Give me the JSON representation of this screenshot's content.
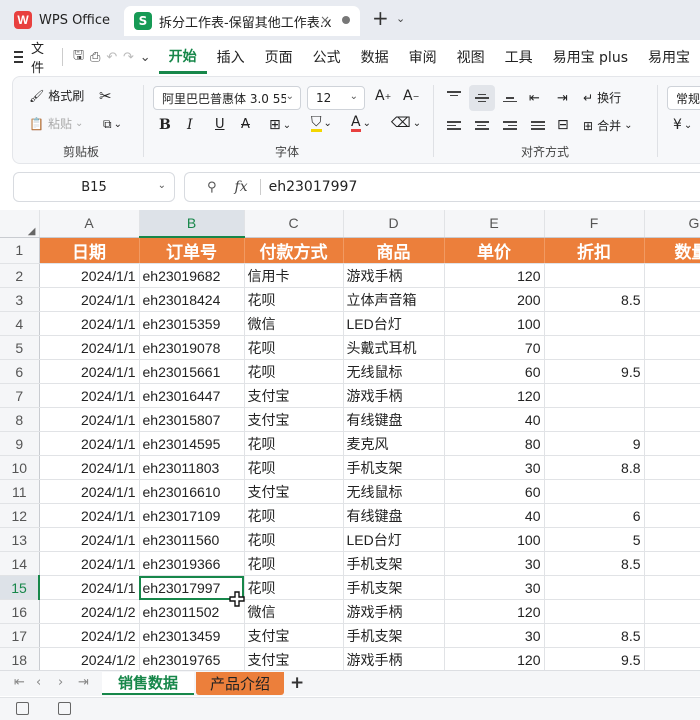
{
  "titlebar": {
    "app_tab": "WPS Office",
    "app_logo": "W",
    "doc_tab": "拆分工作表-保留其他工作表.x",
    "doc_logo": "S",
    "close_glyph": "×",
    "newtab_glyph": "+"
  },
  "menubar": {
    "file": "文件",
    "items": [
      "开始",
      "插入",
      "页面",
      "公式",
      "数据",
      "审阅",
      "视图",
      "工具",
      "易用宝 plus",
      "易用宝"
    ]
  },
  "ribbon": {
    "format_painter": "格式刷",
    "paste": "粘贴",
    "clipboard_group": "剪贴板",
    "font_name": "阿里巴巴普惠体 3.0 55",
    "font_size": "12",
    "font_group": "字体",
    "wrap": "换行",
    "merge": "合并",
    "align_group": "对齐方式",
    "number_format": "常规",
    "currency_glyph": "¥"
  },
  "formula_bar": {
    "cell_ref": "B15",
    "fx": "fx",
    "value": "eh23017997"
  },
  "grid": {
    "columns": [
      "A",
      "B",
      "C",
      "D",
      "E",
      "F",
      "G"
    ],
    "selected_column": "B",
    "selected_row": "15",
    "header_row_num": "1",
    "headers": [
      "日期",
      "订单号",
      "付款方式",
      "商品",
      "单价",
      "折扣",
      "数量"
    ],
    "rows": [
      {
        "n": "2",
        "date": "2024/1/1",
        "order": "eh23019682",
        "pay": "信用卡",
        "item": "游戏手柄",
        "price": "120",
        "disc": ""
      },
      {
        "n": "3",
        "date": "2024/1/1",
        "order": "eh23018424",
        "pay": "花呗",
        "item": "立体声音箱",
        "price": "200",
        "disc": "8.5"
      },
      {
        "n": "4",
        "date": "2024/1/1",
        "order": "eh23015359",
        "pay": "微信",
        "item": "LED台灯",
        "price": "100",
        "disc": ""
      },
      {
        "n": "5",
        "date": "2024/1/1",
        "order": "eh23019078",
        "pay": "花呗",
        "item": "头戴式耳机",
        "price": "70",
        "disc": ""
      },
      {
        "n": "6",
        "date": "2024/1/1",
        "order": "eh23015661",
        "pay": "花呗",
        "item": "无线鼠标",
        "price": "60",
        "disc": "9.5"
      },
      {
        "n": "7",
        "date": "2024/1/1",
        "order": "eh23016447",
        "pay": "支付宝",
        "item": "游戏手柄",
        "price": "120",
        "disc": ""
      },
      {
        "n": "8",
        "date": "2024/1/1",
        "order": "eh23015807",
        "pay": "支付宝",
        "item": "有线键盘",
        "price": "40",
        "disc": ""
      },
      {
        "n": "9",
        "date": "2024/1/1",
        "order": "eh23014595",
        "pay": "花呗",
        "item": "麦克风",
        "price": "80",
        "disc": "9"
      },
      {
        "n": "10",
        "date": "2024/1/1",
        "order": "eh23011803",
        "pay": "花呗",
        "item": "手机支架",
        "price": "30",
        "disc": "8.8"
      },
      {
        "n": "11",
        "date": "2024/1/1",
        "order": "eh23016610",
        "pay": "支付宝",
        "item": "无线鼠标",
        "price": "60",
        "disc": ""
      },
      {
        "n": "12",
        "date": "2024/1/1",
        "order": "eh23017109",
        "pay": "花呗",
        "item": "有线键盘",
        "price": "40",
        "disc": "6"
      },
      {
        "n": "13",
        "date": "2024/1/1",
        "order": "eh23011560",
        "pay": "花呗",
        "item": "LED台灯",
        "price": "100",
        "disc": "5"
      },
      {
        "n": "14",
        "date": "2024/1/1",
        "order": "eh23019366",
        "pay": "花呗",
        "item": "手机支架",
        "price": "30",
        "disc": "8.5"
      },
      {
        "n": "15",
        "date": "2024/1/1",
        "order": "eh23017997",
        "pay": "花呗",
        "item": "手机支架",
        "price": "30",
        "disc": ""
      },
      {
        "n": "16",
        "date": "2024/1/2",
        "order": "eh23011502",
        "pay": "微信",
        "item": "游戏手柄",
        "price": "120",
        "disc": ""
      },
      {
        "n": "17",
        "date": "2024/1/2",
        "order": "eh23013459",
        "pay": "支付宝",
        "item": "手机支架",
        "price": "30",
        "disc": "8.5"
      },
      {
        "n": "18",
        "date": "2024/1/2",
        "order": "eh23019765",
        "pay": "支付宝",
        "item": "游戏手柄",
        "price": "120",
        "disc": "9.5"
      }
    ]
  },
  "sheets": {
    "tabs": [
      "销售数据",
      "产品介绍"
    ],
    "active": "销售数据",
    "add_glyph": "+"
  },
  "colors": {
    "accent": "#17874a",
    "header_fill": "#ec7f3b"
  }
}
